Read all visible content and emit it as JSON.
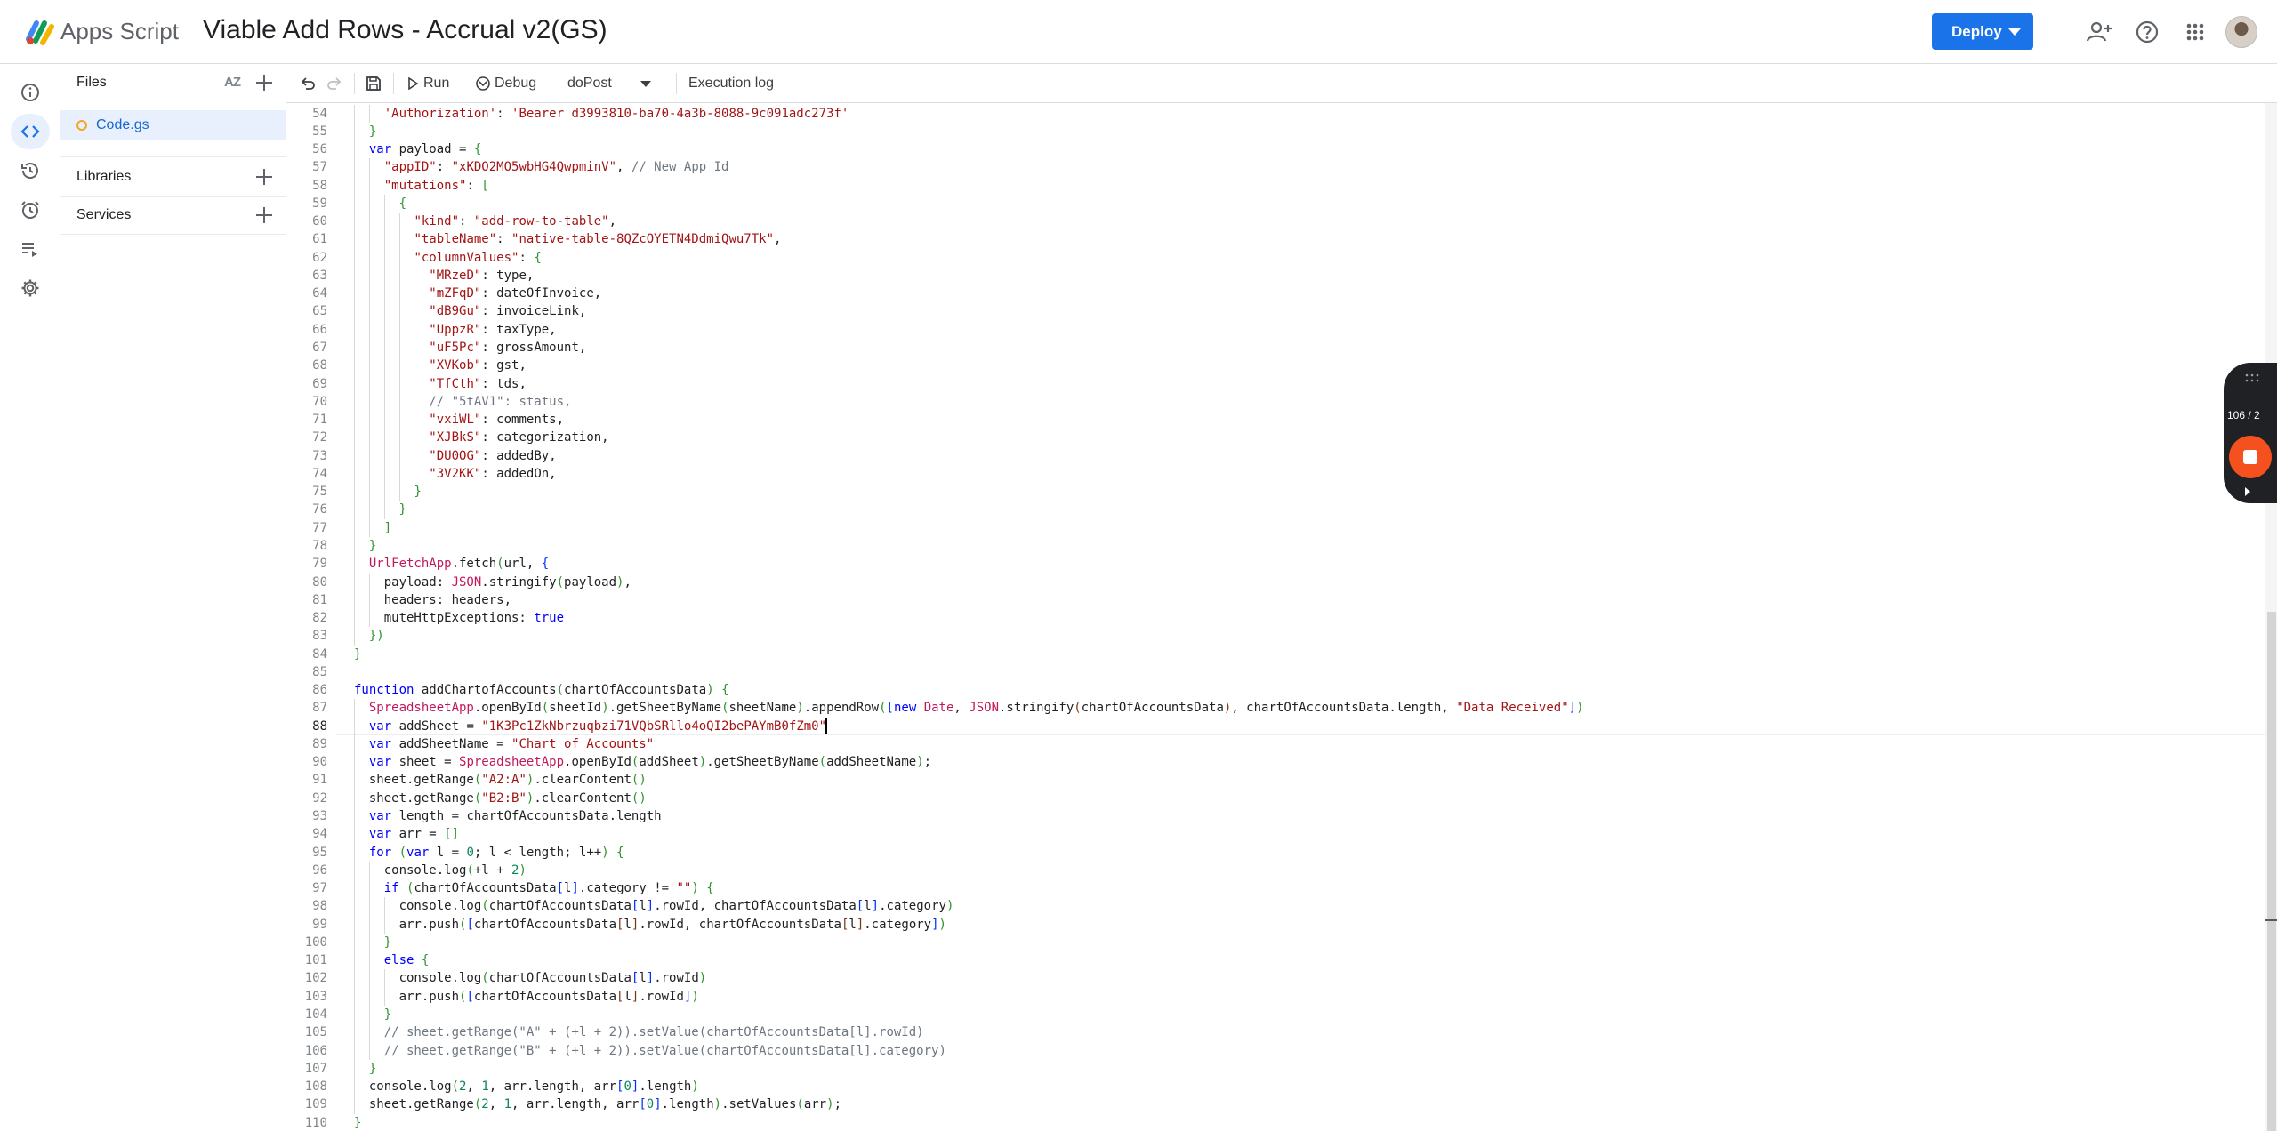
{
  "header": {
    "app_name": "Apps Script",
    "project_title": "Viable Add Rows - Accrual v2(GS)",
    "deploy_label": "Deploy",
    "icons": [
      "add-person-icon",
      "help-icon",
      "apps-grid-icon"
    ]
  },
  "rail": {
    "items": [
      "info-icon",
      "code-icon",
      "history-icon",
      "alarm-icon",
      "executions-icon",
      "settings-icon"
    ],
    "active": "code-icon"
  },
  "files_panel": {
    "files_title": "Files",
    "sort_label": "AZ",
    "file_name": "Code.gs",
    "libraries_title": "Libraries",
    "services_title": "Services"
  },
  "toolbar": {
    "run_label": "Run",
    "debug_label": "Debug",
    "function_name": "doPost",
    "execution_log_label": "Execution log"
  },
  "recorder": {
    "count": "106 / 2"
  },
  "colors": {
    "accent": "#1a73e8",
    "active_bg": "#e8f0fe",
    "keyword": "#0000ff",
    "string": "#a31515",
    "comment": "#6e7781",
    "type": "#c2185b"
  },
  "editor": {
    "current_line": 88,
    "lines": [
      {
        "n": "54",
        "t": "    'Authorization': 'Bearer d3993810-ba70-4a3b-8088-9c091adc273f'"
      },
      {
        "n": "55",
        "t": "  }"
      },
      {
        "n": "56",
        "t": "  var payload = {"
      },
      {
        "n": "57",
        "t": "    \"appID\": \"xKDO2MO5wbHG4QwpminV\", // New App Id"
      },
      {
        "n": "58",
        "t": "    \"mutations\": ["
      },
      {
        "n": "59",
        "t": "      {"
      },
      {
        "n": "60",
        "t": "        \"kind\": \"add-row-to-table\","
      },
      {
        "n": "61",
        "t": "        \"tableName\": \"native-table-8QZcOYETN4DdmiQwu7Tk\","
      },
      {
        "n": "62",
        "t": "        \"columnValues\": {"
      },
      {
        "n": "63",
        "t": "          \"MRzeD\": type,"
      },
      {
        "n": "64",
        "t": "          \"mZFqD\": dateOfInvoice,"
      },
      {
        "n": "65",
        "t": "          \"dB9Gu\": invoiceLink,"
      },
      {
        "n": "66",
        "t": "          \"UppzR\": taxType,"
      },
      {
        "n": "67",
        "t": "          \"uF5Pc\": grossAmount,"
      },
      {
        "n": "68",
        "t": "          \"XVKob\": gst,"
      },
      {
        "n": "69",
        "t": "          \"TfCth\": tds,"
      },
      {
        "n": "70",
        "t": "          // \"5tAV1\": status,"
      },
      {
        "n": "71",
        "t": "          \"vxiWL\": comments,"
      },
      {
        "n": "72",
        "t": "          \"XJBkS\": categorization,"
      },
      {
        "n": "73",
        "t": "          \"DU0OG\": addedBy,"
      },
      {
        "n": "74",
        "t": "          \"3V2KK\": addedOn,"
      },
      {
        "n": "75",
        "t": "        }"
      },
      {
        "n": "76",
        "t": "      }"
      },
      {
        "n": "77",
        "t": "    ]"
      },
      {
        "n": "78",
        "t": "  }"
      },
      {
        "n": "79",
        "t": "  UrlFetchApp.fetch(url, {"
      },
      {
        "n": "80",
        "t": "    payload: JSON.stringify(payload),"
      },
      {
        "n": "81",
        "t": "    headers: headers,"
      },
      {
        "n": "82",
        "t": "    muteHttpExceptions: true"
      },
      {
        "n": "83",
        "t": "  })"
      },
      {
        "n": "84",
        "t": "}"
      },
      {
        "n": "85",
        "t": ""
      },
      {
        "n": "86",
        "t": "function addChartofAccounts(chartOfAccountsData) {"
      },
      {
        "n": "87",
        "t": "  SpreadsheetApp.openById(sheetId).getSheetByName(sheetName).appendRow([new Date, JSON.stringify(chartOfAccountsData), chartOfAccountsData.length, \"Data Received\"])"
      },
      {
        "n": "88",
        "t": "  var addSheet = \"1K3Pc1ZkNbrzuqbzi71VQbSRllo4oQI2bePAYmB0fZm0\""
      },
      {
        "n": "89",
        "t": "  var addSheetName = \"Chart of Accounts\""
      },
      {
        "n": "90",
        "t": "  var sheet = SpreadsheetApp.openById(addSheet).getSheetByName(addSheetName);"
      },
      {
        "n": "91",
        "t": "  sheet.getRange(\"A2:A\").clearContent()"
      },
      {
        "n": "92",
        "t": "  sheet.getRange(\"B2:B\").clearContent()"
      },
      {
        "n": "93",
        "t": "  var length = chartOfAccountsData.length"
      },
      {
        "n": "94",
        "t": "  var arr = []"
      },
      {
        "n": "95",
        "t": "  for (var l = 0; l < length; l++) {"
      },
      {
        "n": "96",
        "t": "    console.log(+l + 2)"
      },
      {
        "n": "97",
        "t": "    if (chartOfAccountsData[l].category != \"\") {"
      },
      {
        "n": "98",
        "t": "      console.log(chartOfAccountsData[l].rowId, chartOfAccountsData[l].category)"
      },
      {
        "n": "99",
        "t": "      arr.push([chartOfAccountsData[l].rowId, chartOfAccountsData[l].category])"
      },
      {
        "n": "100",
        "t": "    }"
      },
      {
        "n": "101",
        "t": "    else {"
      },
      {
        "n": "102",
        "t": "      console.log(chartOfAccountsData[l].rowId)"
      },
      {
        "n": "103",
        "t": "      arr.push([chartOfAccountsData[l].rowId])"
      },
      {
        "n": "104",
        "t": "    }"
      },
      {
        "n": "105",
        "t": "    // sheet.getRange(\"A\" + (+l + 2)).setValue(chartOfAccountsData[l].rowId)"
      },
      {
        "n": "106",
        "t": "    // sheet.getRange(\"B\" + (+l + 2)).setValue(chartOfAccountsData[l].category)"
      },
      {
        "n": "107",
        "t": "  }"
      },
      {
        "n": "108",
        "t": "  console.log(2, 1, arr.length, arr[0].length)"
      },
      {
        "n": "109",
        "t": "  sheet.getRange(2, 1, arr.length, arr[0].length).setValues(arr);"
      },
      {
        "n": "110",
        "t": "}"
      }
    ]
  }
}
